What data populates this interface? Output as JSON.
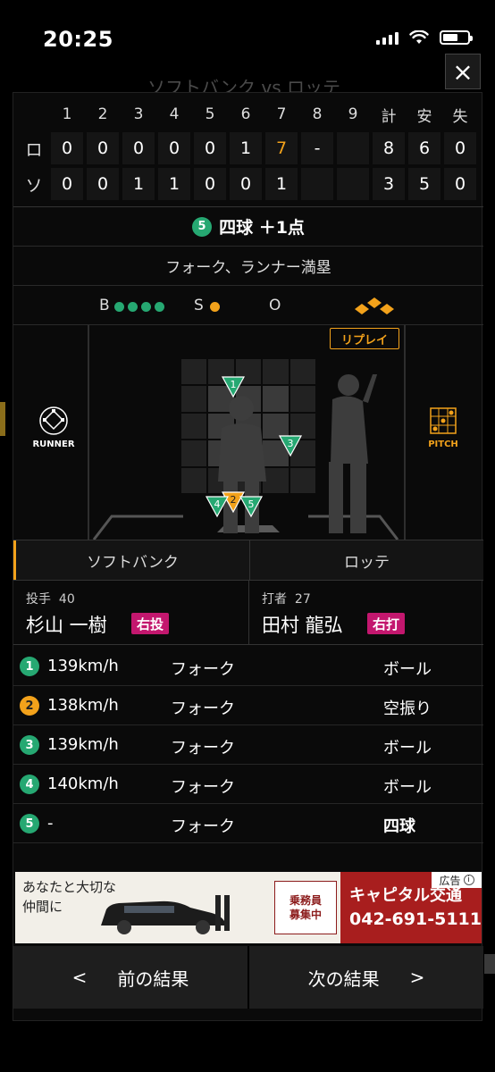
{
  "status_bar": {
    "time": "20:25"
  },
  "background": {
    "title": "ソフトバンク vs ロッテ"
  },
  "close_label": "×",
  "scoreboard": {
    "headers": [
      "1",
      "2",
      "3",
      "4",
      "5",
      "6",
      "7",
      "8",
      "9",
      "計",
      "安",
      "失"
    ],
    "rows": [
      {
        "team": "ロ",
        "innings": [
          "0",
          "0",
          "0",
          "0",
          "0",
          "1",
          "7",
          "-",
          ""
        ],
        "totals": [
          "8",
          "6",
          "0"
        ]
      },
      {
        "team": "ソ",
        "innings": [
          "0",
          "0",
          "1",
          "1",
          "0",
          "0",
          "1",
          "",
          ""
        ],
        "totals": [
          "3",
          "5",
          "0"
        ]
      }
    ]
  },
  "play": {
    "number": "5",
    "result": "四球 ＋1点",
    "description": "フォーク、ランナー満塁"
  },
  "count": {
    "balls_label": "B",
    "strikes_label": "S",
    "outs_label": "O",
    "balls": 4,
    "strikes": 1,
    "outs": 0
  },
  "field": {
    "runner_label": "RUNNER",
    "pitch_label": "PITCH",
    "replay_label": "リプレイ"
  },
  "teams": {
    "home": "ソフトバンク",
    "away": "ロッテ"
  },
  "pitcher": {
    "role": "投手",
    "number": "40",
    "name": "杉山 一樹",
    "hand": "右投"
  },
  "batter": {
    "role": "打者",
    "number": "27",
    "name": "田村 龍弘",
    "hand": "右打"
  },
  "pitches": [
    {
      "num": "1",
      "speed": "139km/h",
      "type": "フォーク",
      "result": "ボール",
      "color": "#26a872"
    },
    {
      "num": "2",
      "speed": "138km/h",
      "type": "フォーク",
      "result": "空振り",
      "color": "#f3a21b"
    },
    {
      "num": "3",
      "speed": "139km/h",
      "type": "フォーク",
      "result": "ボール",
      "color": "#26a872"
    },
    {
      "num": "4",
      "speed": "140km/h",
      "type": "フォーク",
      "result": "ボール",
      "color": "#26a872"
    },
    {
      "num": "5",
      "speed": "-",
      "type": "フォーク",
      "result": "四球",
      "color": "#26a872"
    }
  ],
  "ad": {
    "label": "広告",
    "copy_line1": "あなたと大切な",
    "copy_line2": "仲間に",
    "recruit_line1": "乗務員",
    "recruit_line2": "募集中",
    "brand": "キャピタル交通",
    "phone": "042-691-5111"
  },
  "nav": {
    "prev_label": "前の結果",
    "next_label": "次の結果",
    "prev_arrow": "<",
    "next_arrow": ">"
  },
  "colors": {
    "green": "#26a872",
    "orange": "#f3a21b",
    "magenta": "#c3176e"
  }
}
